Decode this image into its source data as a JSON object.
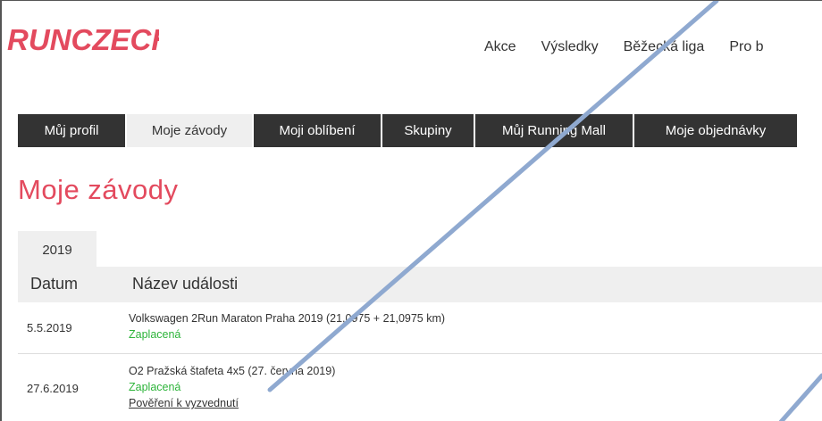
{
  "brand": {
    "logo_text": "RUNCZECH",
    "accent": "#e34a5e",
    "dark": "#333333"
  },
  "topnav": {
    "items": [
      "Akce",
      "Výsledky",
      "Běžecká liga",
      "Pro b"
    ]
  },
  "tabs": {
    "items": [
      {
        "label": "Můj profil"
      },
      {
        "label": "Moje závody"
      },
      {
        "label": "Moji oblíbení"
      },
      {
        "label": "Skupiny"
      },
      {
        "label": "Můj Running Mall"
      },
      {
        "label": "Moje objednávky"
      }
    ],
    "active": "Moje závody"
  },
  "page": {
    "title": "Moje závody",
    "year_tab": "2019"
  },
  "table": {
    "headers": {
      "date": "Datum",
      "name": "Název události"
    },
    "rows": [
      {
        "date": "5.5.2019",
        "event": "Volkswagen 2Run Maraton Praha 2019 (21,0975 + 21,0975 km)",
        "status": "Zaplacená"
      },
      {
        "date": "27.6.2019",
        "event": "O2 Pražská štafeta 4x5 (27. června 2019)",
        "status": "Zaplacená",
        "link": "Pověření k vyzvednutí"
      }
    ]
  },
  "colors": {
    "status_paid": "#2db43a",
    "overlay_line": "#8fa9d0"
  }
}
